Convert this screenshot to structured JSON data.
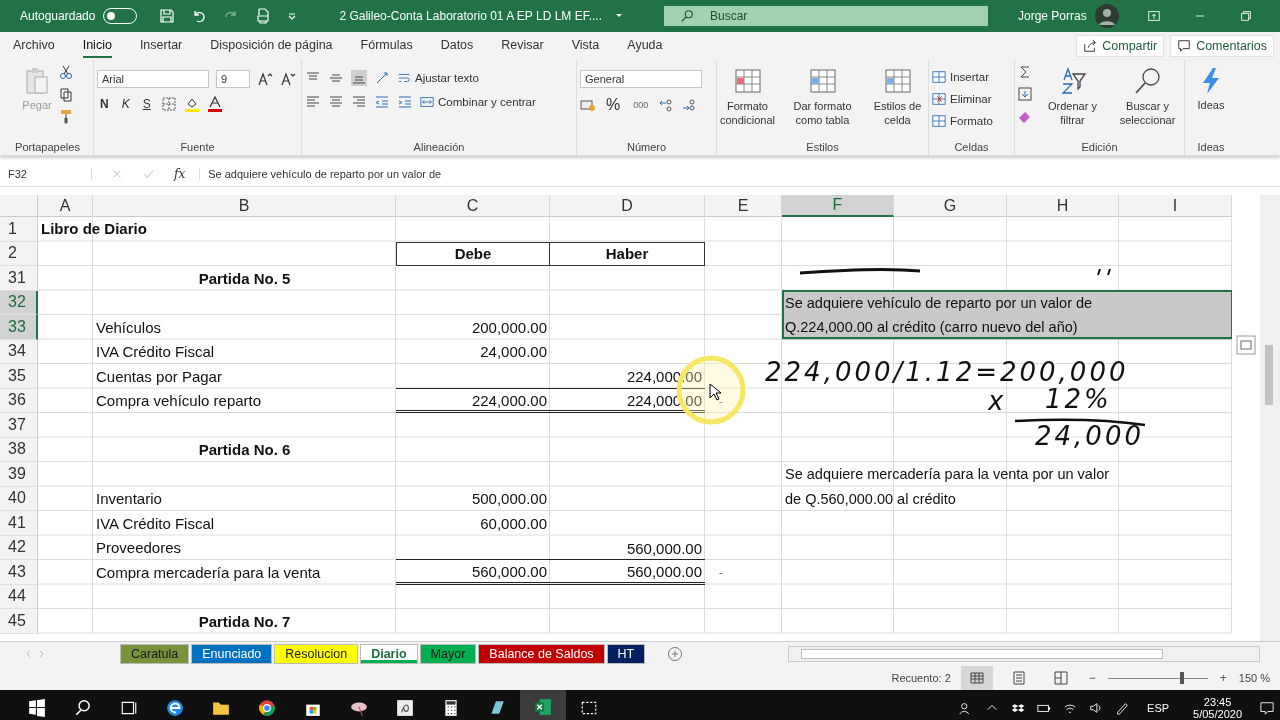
{
  "title_bar": {
    "autosave_label": "Autoguardado",
    "autosave_on": false,
    "doc_title": "2 Galileo-Conta Laboratorio 01 A EP LD LM EF....",
    "search_placeholder": "Buscar",
    "user": "Jorge Porras"
  },
  "menu_tabs": [
    {
      "label": "Archivo",
      "selected": false
    },
    {
      "label": "Inicio",
      "selected": true
    },
    {
      "label": "Insertar",
      "selected": false
    },
    {
      "label": "Disposición de página",
      "selected": false
    },
    {
      "label": "Fórmulas",
      "selected": false
    },
    {
      "label": "Datos",
      "selected": false
    },
    {
      "label": "Revisar",
      "selected": false
    },
    {
      "label": "Vista",
      "selected": false
    },
    {
      "label": "Ayuda",
      "selected": false
    }
  ],
  "share_button": "Compartir",
  "comments_button": "Comentarios",
  "ribbon": {
    "paste": "Pegar",
    "font": "Arial",
    "font_size": "9",
    "bold": "N",
    "italic": "K",
    "underline": "S",
    "wrap_text": "Ajustar texto",
    "merge": "Combinar y centrar",
    "number_format": "General",
    "percent": "%",
    "thousands": "000",
    "styles": [
      "Formato condicional",
      "Dar formato como tabla",
      "Estilos de celda"
    ],
    "cells": [
      "Insertar",
      "Eliminar",
      "Formato"
    ],
    "editing": [
      "Ordenar y filtrar",
      "Buscar y seleccionar"
    ],
    "ideas": "Ideas",
    "groups": [
      "Portapapeles",
      "Fuente",
      "Alineación",
      "Número",
      "Estilos",
      "Celdas",
      "Edición",
      "Ideas"
    ]
  },
  "formula_bar": {
    "name_box": "F32",
    "fx": "fx",
    "formula": "Se adquiere vehículo de reparto por un valor de"
  },
  "columns": [
    {
      "label": "A",
      "selected": false
    },
    {
      "label": "B",
      "selected": false
    },
    {
      "label": "C",
      "selected": false
    },
    {
      "label": "D",
      "selected": false
    },
    {
      "label": "E",
      "selected": false
    },
    {
      "label": "F",
      "selected": true
    },
    {
      "label": "G",
      "selected": false
    },
    {
      "label": "H",
      "selected": false
    },
    {
      "label": "I",
      "selected": false
    }
  ],
  "rows": [
    {
      "num": "1",
      "selected": false,
      "kind": "heading",
      "a": "Libro de Diario"
    },
    {
      "num": "2",
      "selected": false,
      "kind": "header",
      "c": "Debe",
      "d": "Haber"
    },
    {
      "num": "31",
      "selected": false,
      "kind": "title",
      "b": "Partida No. 5"
    },
    {
      "num": "32",
      "selected": true,
      "kind": "item",
      "f": "Se adquiere vehículo de reparto por un valor de",
      "f_selected": true
    },
    {
      "num": "33",
      "selected": true,
      "kind": "item",
      "b": "Vehículos",
      "c": "200,000.00",
      "f": "Q.224,000.00 al crédito (carro nuevo del año)",
      "f_selected": true
    },
    {
      "num": "34",
      "selected": false,
      "kind": "item",
      "b": "IVA Crédito Fiscal",
      "c": "24,000.00"
    },
    {
      "num": "35",
      "selected": false,
      "kind": "item",
      "b": "Cuentas por Pagar",
      "d": "224,000.00",
      "underline": true
    },
    {
      "num": "36",
      "selected": false,
      "kind": "item",
      "b": "Compra vehículo reparto",
      "c": "224,000.00",
      "d": "224,000.00",
      "e": "-",
      "double_underline": true
    },
    {
      "num": "37",
      "selected": false,
      "kind": "item"
    },
    {
      "num": "38",
      "selected": false,
      "kind": "title",
      "b": "Partida No. 6"
    },
    {
      "num": "39",
      "selected": false,
      "kind": "item",
      "f": "Se adquiere mercadería para la venta por un valor"
    },
    {
      "num": "40",
      "selected": false,
      "kind": "item",
      "b": "Inventario",
      "c": "500,000.00",
      "f": "de Q.560,000.00 al crédito"
    },
    {
      "num": "41",
      "selected": false,
      "kind": "item",
      "b": "IVA Crédito Fiscal",
      "c": "60,000.00"
    },
    {
      "num": "42",
      "selected": false,
      "kind": "item",
      "b": "Proveedores",
      "d": "560,000.00",
      "underline": true
    },
    {
      "num": "43",
      "selected": false,
      "kind": "item",
      "b": "Compra mercadería para la venta",
      "c": "560,000.00",
      "d": "560,000.00",
      "e": "-",
      "double_underline": true
    },
    {
      "num": "44",
      "selected": false,
      "kind": "item"
    },
    {
      "num": "45",
      "selected": false,
      "kind": "title",
      "b": "Partida No. 7"
    }
  ],
  "ink": [
    "224,000/1.12=200,000",
    "x",
    "12%",
    "24,000"
  ],
  "sheet_tabs": [
    {
      "label": "Caratula",
      "color": "#77933c",
      "selected": false
    },
    {
      "label": "Enunciado",
      "color": "#0070c0",
      "selected": false
    },
    {
      "label": "Resolucion",
      "color": "#ffff00",
      "selected": false
    },
    {
      "label": "Diario",
      "color": "#00b050",
      "selected": true
    },
    {
      "label": "Mayor",
      "color": "#00b050",
      "selected": false
    },
    {
      "label": "Balance de Saldos",
      "color": "#c00000",
      "selected": false
    },
    {
      "label": "HT",
      "color": "#002060",
      "selected": false
    }
  ],
  "status_bar": {
    "count": "Recuento: 2",
    "zoom_out": "−",
    "zoom_in": "+",
    "zoom": "150 %",
    "level": 0.72
  },
  "taskbar": {
    "lang": "ESP",
    "time": "23:45",
    "date": "5/05/2020"
  }
}
